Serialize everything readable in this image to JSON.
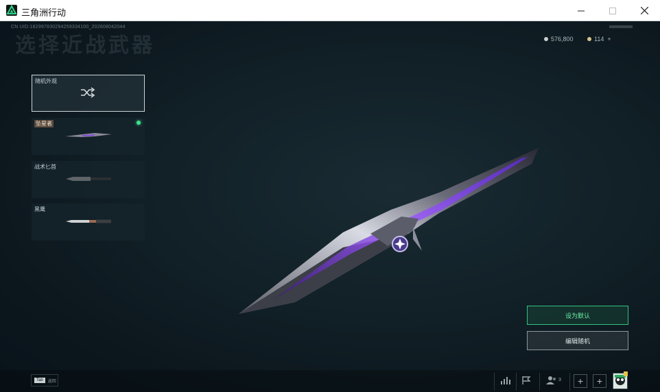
{
  "window": {
    "title": "三角洲行动"
  },
  "header": {
    "uid_text": "CN UID:18299783029425933410​0_202608042044",
    "page_title": "选择近战武器"
  },
  "currency": {
    "coins": "576,800",
    "tokens": "114",
    "tokens_add": "+"
  },
  "weapons": {
    "items": [
      {
        "label": "随机外观",
        "icon": "shuffle-icon",
        "selected": true
      },
      {
        "label": "坠星者",
        "equipped": true
      },
      {
        "label": "战术匕首"
      },
      {
        "label": "黑鹰"
      }
    ]
  },
  "actions": {
    "set_default": "设为默认",
    "edit_random": "编辑随机"
  },
  "bottombar": {
    "key": "Tab",
    "key_label": "返回",
    "friends_count": "3"
  },
  "colors": {
    "accent_green": "#33c47f",
    "blade_purple": "#8a4bff"
  }
}
